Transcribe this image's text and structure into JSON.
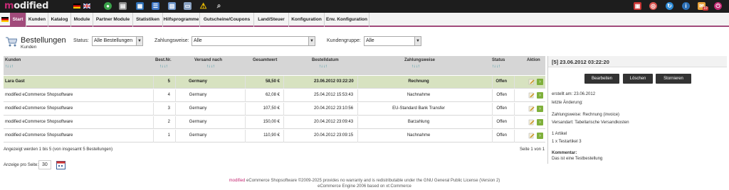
{
  "logo": {
    "prefix": "m",
    "rest": "odified"
  },
  "nav": {
    "start": "Start",
    "items": [
      "Kunden",
      "Katalog",
      "Module",
      "Partner Module",
      "Statistiken",
      "Hilfsprogramme",
      "Gutscheine/Coupons",
      "Land/Steuer",
      "Konfiguration",
      "Erw. Konfiguration"
    ]
  },
  "notification_count": "10",
  "page": {
    "title": "Bestellungen",
    "subtitle": "Kunden"
  },
  "filters": {
    "status_label": "Status:",
    "status_value": "Alle Bestellungen",
    "payment_label": "Zahlungsweise:",
    "payment_value": "Alle",
    "group_label": "Kundengruppe:",
    "group_value": "Alle"
  },
  "table": {
    "headers": [
      "Kunden",
      "Best.Nr.",
      "Versand nach",
      "Gesamtwert",
      "Bestelldatum",
      "Zahlungsweise",
      "Status",
      "Aktion"
    ],
    "sort_glyph": "↑↓ ↓↑",
    "rows": [
      {
        "customer": "Lara Gast",
        "nr": "5",
        "ship": "Germany",
        "total": "58,50 €",
        "date": "23.06.2012 03:22:20",
        "payment": "Rechnung",
        "status": "Offen",
        "selected": true
      },
      {
        "customer": "modified eCommerce Shopsoftware",
        "nr": "4",
        "ship": "Germany",
        "total": "62,08 €",
        "date": "25.04.2012 15:53:43",
        "payment": "Nachnahme",
        "status": "Offen",
        "selected": false
      },
      {
        "customer": "modified eCommerce Shopsoftware",
        "nr": "3",
        "ship": "Germany",
        "total": "107,50 €",
        "date": "20.04.2012 23:10:56",
        "payment": "EU-Standard Bank Transfer",
        "status": "Offen",
        "selected": false
      },
      {
        "customer": "modified eCommerce Shopsoftware",
        "nr": "2",
        "ship": "Germany",
        "total": "150,00 €",
        "date": "20.04.2012 23:09:43",
        "payment": "Barzahlung",
        "status": "Offen",
        "selected": false
      },
      {
        "customer": "modified eCommerce Shopsoftware",
        "nr": "1",
        "ship": "Germany",
        "total": "110,90 €",
        "date": "20.04.2012 23:09:15",
        "payment": "Nachnahme",
        "status": "Offen",
        "selected": false
      }
    ]
  },
  "summary": {
    "shown": "Angezeigt werden 1 bis 5 (von insgesamt 5 Bestellungen)",
    "page": "Seite 1 von 1",
    "per_page_label": "Anzeige pro Seite:",
    "per_page_value": "30"
  },
  "detail": {
    "title": "[5]  23.06.2012 03:22:20",
    "buttons": [
      "Bearbeiten",
      "Löschen",
      "Stornieren"
    ],
    "created": "erstellt am: 23.06.2012",
    "changed": "letzte Änderung:",
    "payment": "Zahlungsweise: Rechnung (invoice)",
    "shipping": "Versandart: Tabellarische Versandkosten",
    "article_count": "1 Artikel",
    "article": "1 x Testartikel 3",
    "comment_label": "Kommentar:",
    "comment": "Das ist eine Testbestellung"
  },
  "credit": {
    "brand": "modified",
    "line1": " eCommerce Shopsoftware ©2009-2025 provides no warranty and is redistributable under the GNU General Public License (Version 2)",
    "line2": "eCommerce Engine 2006 based on xt:Commerce"
  },
  "colors": {
    "accent": "#a14b7b",
    "brand": "#c52a74",
    "selected_row": "#d7e2c0",
    "topbar": "#1d1d1d"
  }
}
